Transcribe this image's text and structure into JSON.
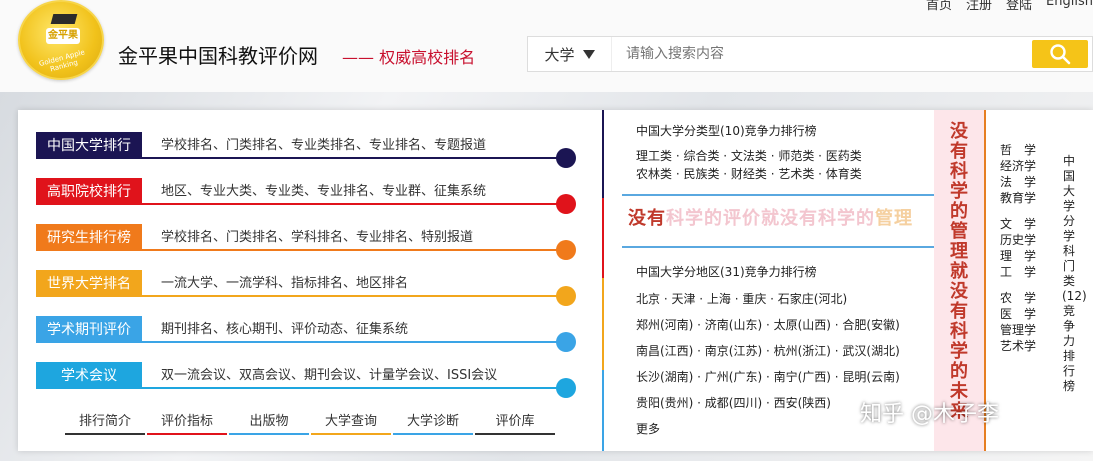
{
  "top_links": [
    "首页",
    "注册",
    "登陆",
    "English"
  ],
  "site": {
    "logo_text": "金平果",
    "logo_ring": "Golden Apple Ranking",
    "title": "金平果中国科教评价网",
    "slogan": "—— 权威高校排名"
  },
  "search": {
    "type": "大学",
    "placeholder": "请输入搜索内容"
  },
  "rows": [
    {
      "label": "中国大学排行",
      "links": "学校排名、门类排名、专业类排名、专业排名、专题报道",
      "color": "#1b1553"
    },
    {
      "label": "高职院校排行",
      "links": "地区、专业大类、专业类、专业排名、专业群、征集系统",
      "color": "#e0131b"
    },
    {
      "label": "研究生排行榜",
      "links": "学校排名、门类排名、学科排名、专业排名、特别报道",
      "color": "#f07a1b"
    },
    {
      "label": "世界大学排名",
      "links": "一流大学、一流学科、指标排名、地区排名",
      "color": "#f2a61c"
    },
    {
      "label": "学术期刊评价",
      "links": "期刊排名、核心期刊、评价动态、征集系统",
      "color": "#3aa4e6"
    },
    {
      "label": "学术会议",
      "links": "双一流会议、双高会议、期刊会议、计量学会议、ISSI会议",
      "color": "#1ea6df"
    }
  ],
  "bottom_nav": [
    "排行简介",
    "评价指标",
    "出版物",
    "大学查询",
    "大学诊断",
    "评价库"
  ],
  "types": {
    "title": "中国大学分类型(10)竞争力排行榜",
    "line1": "理工类 · 综合类 · 文法类 · 师范类 · 医药类",
    "line2": "农林类 · 民族类 · 财经类 · 艺术类 · 体育类"
  },
  "banner": {
    "part1": "没有",
    "part2": "科学的评价就没有科学的",
    "part3": "管理"
  },
  "vbanner": "没有科学的管理就没有科学的未来",
  "regions": {
    "title": "中国大学分地区(31)竞争力排行榜",
    "lines": [
      "北京 · 天津 · 上海 · 重庆 · 石家庄(河北)",
      "郑州(河南) · 济南(山东) · 太原(山西) · 合肥(安徽)",
      "南昌(江西) · 南京(江苏) · 杭州(浙江) · 武汉(湖北)",
      "长沙(湖南) · 广州(广东) · 南宁(广西) · 昆明(云南)",
      "贵阳(贵州) · 成都(四川) · 西安(陕西)",
      "更多"
    ]
  },
  "disciplines": [
    "哲　学",
    "经济学",
    "法　学",
    "教育学",
    "",
    "文　学",
    "历史学",
    "理　学",
    "工　学",
    "",
    "农　学",
    "医　学",
    "管理学",
    "艺术学"
  ],
  "right_col": "中国大学分学科门类(12)竞争力排行榜",
  "watermark": "知乎 @木子李"
}
